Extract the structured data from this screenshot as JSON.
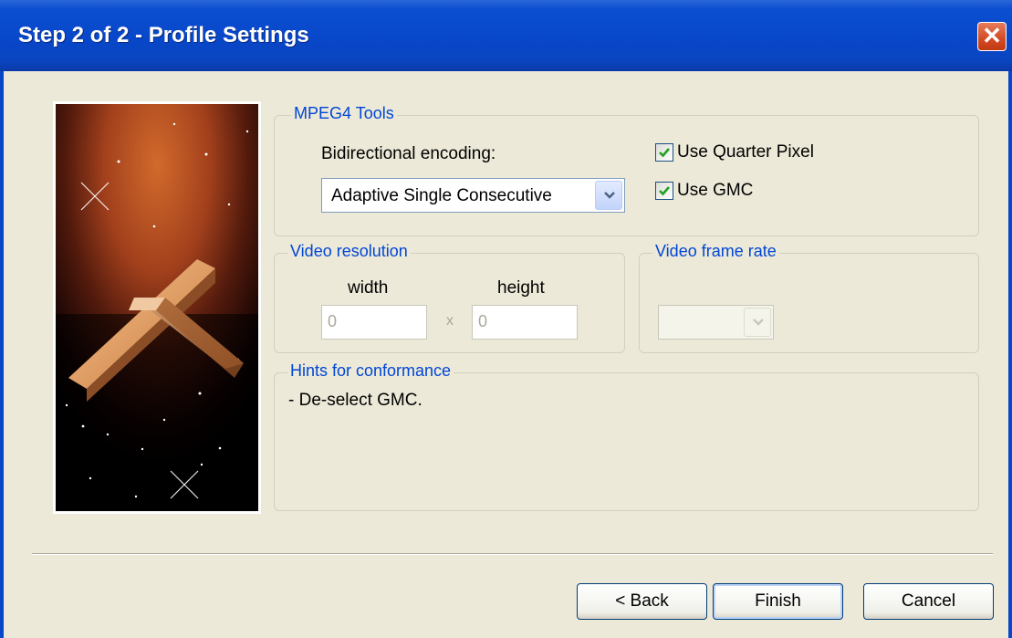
{
  "window": {
    "title": "Step 2 of 2 - Profile Settings",
    "close_glyph": "✕"
  },
  "mpeg4_tools": {
    "legend": "MPEG4 Tools",
    "bidir_label": "Bidirectional encoding:",
    "bidir_value": "Adaptive Single Consecutive",
    "quarter_pixel": {
      "label": "Use Quarter Pixel",
      "checked": true
    },
    "gmc": {
      "label": "Use GMC",
      "checked": true
    }
  },
  "video_resolution": {
    "legend": "Video resolution",
    "width_label": "width",
    "height_label": "height",
    "width_value": "0",
    "height_value": "0",
    "times": "x"
  },
  "video_frame_rate": {
    "legend": "Video frame rate",
    "value": ""
  },
  "hints": {
    "legend": "Hints for conformance",
    "text": "- De-select GMC."
  },
  "buttons": {
    "back": "< Back",
    "finish": "Finish",
    "cancel": "Cancel"
  },
  "colors": {
    "title_bar": "#0847c9",
    "legend_text": "#0046d5",
    "dialog_bg": "#ece9d8"
  },
  "icons": [
    "close-icon",
    "chevron-down-icon",
    "checkmark-icon"
  ]
}
